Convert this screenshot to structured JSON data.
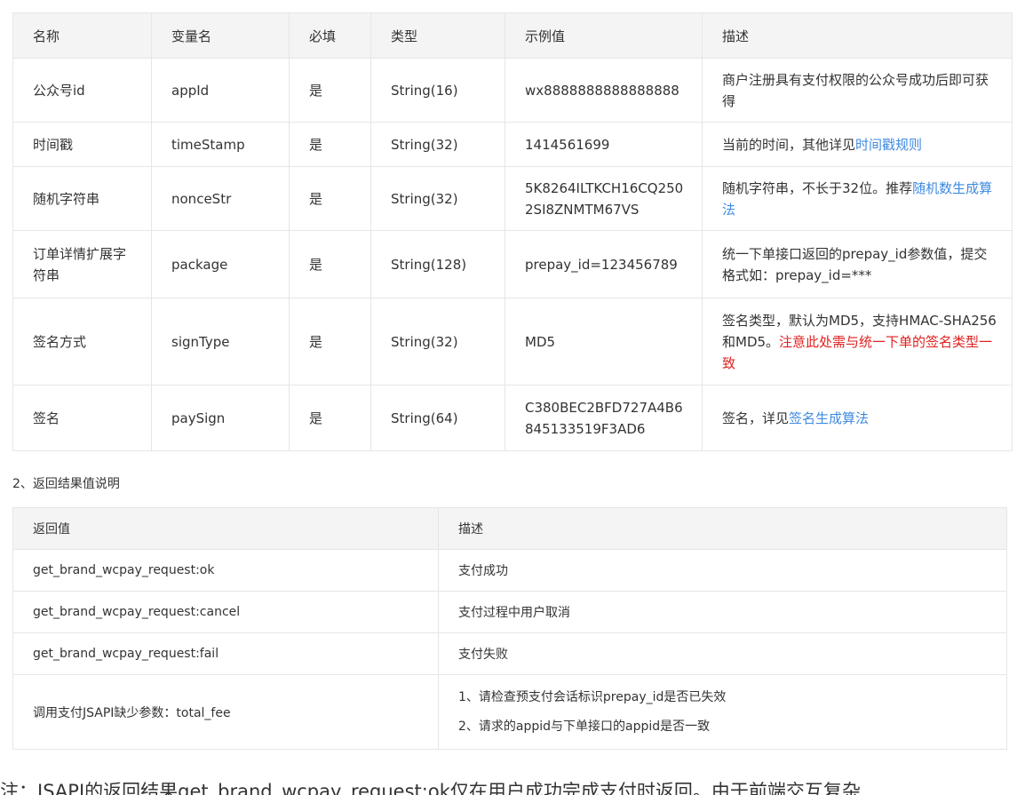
{
  "params_table": {
    "headers": {
      "name": "名称",
      "variable": "变量名",
      "required": "必填",
      "type": "类型",
      "example": "示例值",
      "description": "描述"
    },
    "rows": [
      {
        "name": "公众号id",
        "variable": "appId",
        "required": "是",
        "type": "String(16)",
        "example": "wx8888888888888888",
        "desc_text": "商户注册具有支付权限的公众号成功后即可获得",
        "desc_link": "",
        "desc_warn": ""
      },
      {
        "name": "时间戳",
        "variable": "timeStamp",
        "required": "是",
        "type": "String(32)",
        "example": "1414561699",
        "desc_text": "当前的时间，其他详见",
        "desc_link": "时间戳规则",
        "desc_warn": ""
      },
      {
        "name": "随机字符串",
        "variable": "nonceStr",
        "required": "是",
        "type": "String(32)",
        "example": "5K8264ILTKCH16CQ2502SI8ZNMTM67VS",
        "desc_text": "随机字符串，不长于32位。推荐",
        "desc_link": "随机数生成算法",
        "desc_warn": ""
      },
      {
        "name": "订单详情扩展字符串",
        "variable": "package",
        "required": "是",
        "type": "String(128)",
        "example": "prepay_id=123456789",
        "desc_text": "统一下单接口返回的prepay_id参数值，提交格式如：prepay_id=***",
        "desc_link": "",
        "desc_warn": ""
      },
      {
        "name": "签名方式",
        "variable": "signType",
        "required": "是",
        "type": "String(32)",
        "example": "MD5",
        "desc_text": "签名类型，默认为MD5，支持HMAC-SHA256和MD5。",
        "desc_link": "",
        "desc_warn": "注意此处需与统一下单的签名类型一致"
      },
      {
        "name": "签名",
        "variable": "paySign",
        "required": "是",
        "type": "String(64)",
        "example": "C380BEC2BFD727A4B6845133519F3AD6",
        "desc_text": "签名，详见",
        "desc_link": "签名生成算法",
        "desc_warn": ""
      }
    ]
  },
  "section2": {
    "title": "2、返回结果值说明"
  },
  "return_table": {
    "headers": {
      "value": "返回值",
      "description": "描述"
    },
    "rows": [
      {
        "value": "get_brand_wcpay_request:ok",
        "desc": "支付成功"
      },
      {
        "value": "get_brand_wcpay_request:cancel",
        "desc": "支付过程中用户取消"
      },
      {
        "value": "get_brand_wcpay_request:fail",
        "desc": "支付失败"
      },
      {
        "value": "调用支付JSAPI缺少参数：total_fee",
        "desc_line1": "1、请检查预支付会话标识prepay_id是否已失效",
        "desc_line2": "2、请求的appid与下单接口的appid是否一致"
      }
    ]
  },
  "note": {
    "text": "注：JSAPI的返回结果get_brand_wcpay_request:ok仅在用户成功完成支付时返回。由于前端交互复杂"
  },
  "colors": {
    "link": "#3f8ae0",
    "warning": "#e02020",
    "header_bg": "#f4f4f4",
    "border": "#e6e6e6"
  }
}
